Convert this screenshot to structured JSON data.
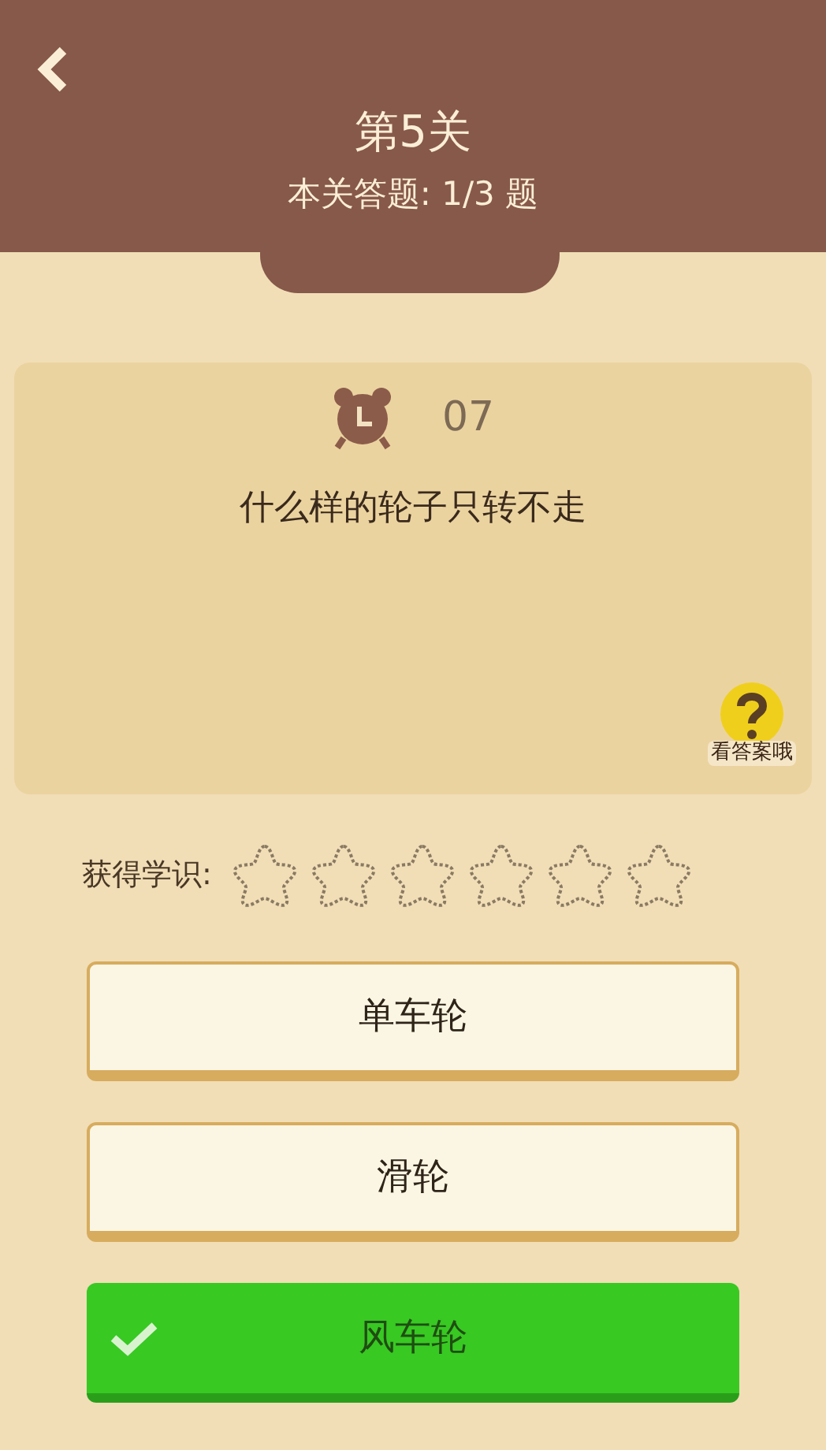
{
  "header": {
    "title": "第5关",
    "progress": "本关答题: 1/3 题"
  },
  "question": {
    "timer": "07",
    "text": "什么样的轮子只转不走",
    "hint_label": "看答案哦"
  },
  "knowledge": {
    "label": "获得学识:",
    "stars": 0
  },
  "options": [
    {
      "label": "单车轮",
      "selected": false
    },
    {
      "label": "滑轮",
      "selected": false
    },
    {
      "label": "风车轮",
      "selected": true
    }
  ]
}
